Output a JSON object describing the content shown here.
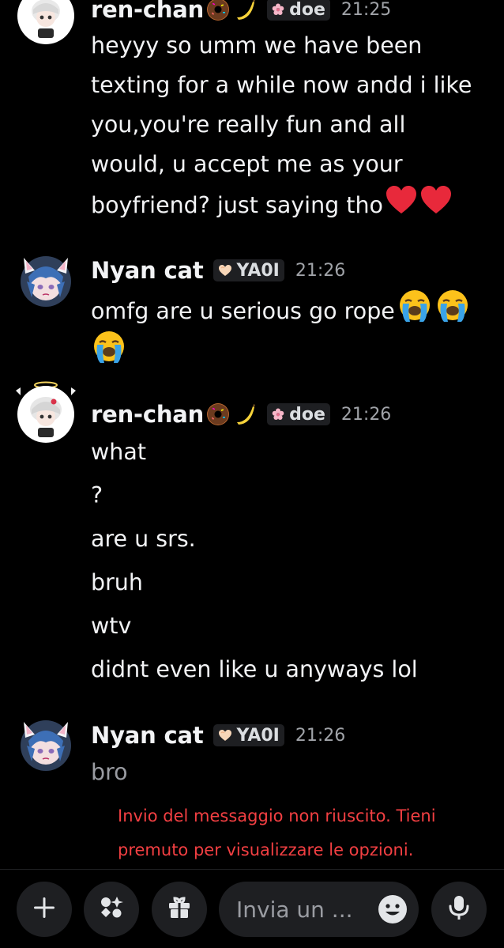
{
  "colors": {
    "background": "#000000",
    "error": "#f23f42",
    "heart": "#e8293b",
    "pill": "#1e1f22"
  },
  "messages": [
    {
      "author": "ren-chan",
      "author_emojis": [
        "doughnut",
        "banana"
      ],
      "tag_icon": "cherry-blossom-icon",
      "tag": "doe",
      "time": "21:25",
      "lines": [
        "heyyy so umm we have been",
        "texting for a while now andd i like",
        "you,you're really fun and all",
        "would, u accept me as your",
        "boyfriend? just saying tho"
      ],
      "trailing_emojis": [
        "red-heart",
        "red-heart"
      ]
    },
    {
      "author": "Nyan cat",
      "tag_icon": "heart-icon",
      "tag": "YA0I",
      "time": "21:26",
      "lines": [
        "omfg are u serious go rope"
      ],
      "trailing_emojis": [
        "loudly-crying-face",
        "loudly-crying-face",
        "loudly-crying-face"
      ]
    },
    {
      "author": "ren-chan",
      "author_emojis": [
        "doughnut",
        "banana"
      ],
      "tag_icon": "cherry-blossom-icon",
      "tag": "doe",
      "time": "21:26",
      "lines": [
        "what",
        "?",
        "are u srs.",
        "bruh",
        "wtv",
        "didnt even like u anyways lol"
      ]
    },
    {
      "author": "Nyan cat",
      "tag_icon": "heart-icon",
      "tag": "YA0I",
      "time": "21:26",
      "lines": [
        "bro"
      ],
      "status": "failed"
    }
  ],
  "error": {
    "line1": "Invio del messaggio non riuscito. Tieni",
    "line2": "premuto per visualizzare le opzioni."
  },
  "composer": {
    "placeholder": "Invia un ...",
    "buttons": [
      "plus-icon",
      "apps-icon",
      "gift-icon"
    ],
    "smiley": "emoji-picker-icon",
    "mic": "microphone-icon"
  }
}
